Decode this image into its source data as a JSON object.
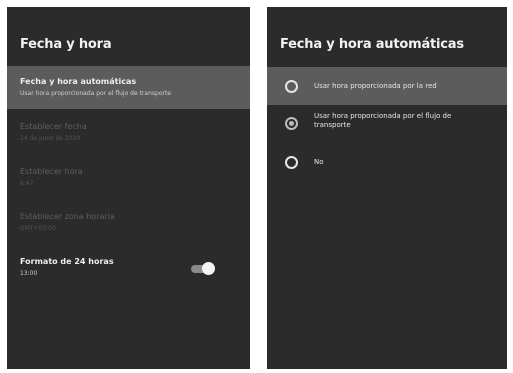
{
  "left_panel": {
    "title": "Fecha y hora",
    "items": [
      {
        "title": "Fecha y hora automáticas",
        "subtitle": "Usar hora proporcionada por el flujo de transporte"
      },
      {
        "title": "Establecer fecha",
        "subtitle": "24 de junio de 2020"
      },
      {
        "title": "Establecer hora",
        "subtitle": "6:47"
      },
      {
        "title": "Establecer zona horaria",
        "subtitle": "GMT+03:00"
      },
      {
        "title": "Formato de 24 horas",
        "subtitle": "13:00"
      }
    ],
    "toggle_on": true
  },
  "right_panel": {
    "title": "Fecha y hora automáticas",
    "options": [
      {
        "label": "Usar hora proporcionada por la red",
        "selected": false
      },
      {
        "label": "Usar hora proporcionada por el flujo de transporte",
        "selected": true
      },
      {
        "label": "No",
        "selected": false
      }
    ]
  },
  "colors": {
    "panel_bg": "#2b2b2b",
    "highlight_bg": "#5c5c5c"
  }
}
